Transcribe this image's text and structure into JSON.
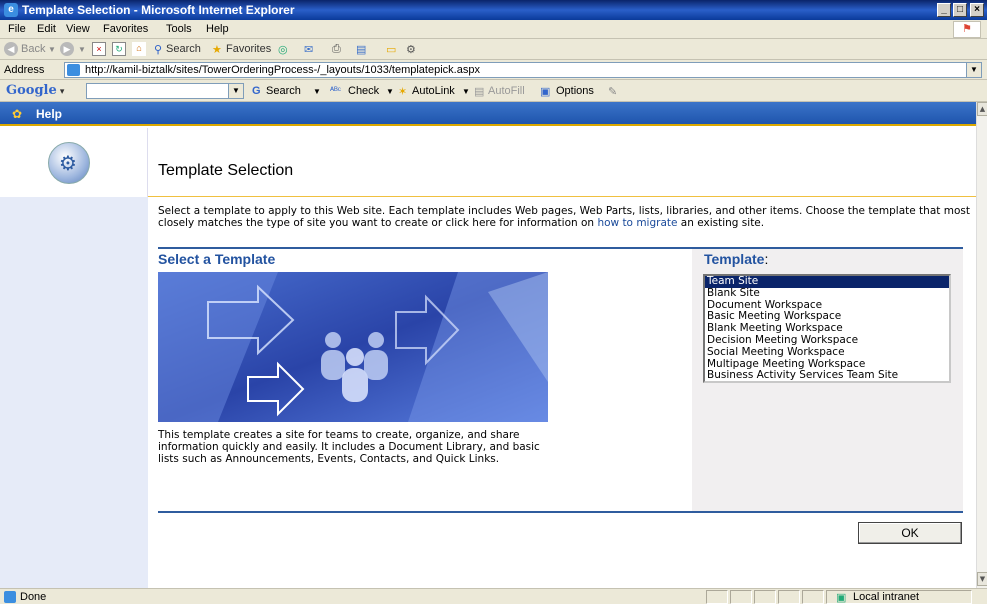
{
  "window": {
    "title": "Template Selection - Microsoft Internet Explorer"
  },
  "menu": [
    "File",
    "Edit",
    "View",
    "Favorites",
    "Tools",
    "Help"
  ],
  "toolbar": {
    "back": "Back",
    "search": "Search",
    "favorites": "Favorites"
  },
  "address": {
    "label": "Address",
    "url": "http://kamil-biztalk/sites/TowerOrderingProcess-/_layouts/1033/templatepick.aspx"
  },
  "google": {
    "logo": "Google",
    "search": "Search",
    "check": "Check",
    "autolink": "AutoLink",
    "autofill": "AutoFill",
    "options": "Options"
  },
  "sharepoint": {
    "help": "Help",
    "page_title": "Template Selection"
  },
  "description": {
    "text_before": "Select a template to apply to this Web site. Each template includes Web pages, Web Parts, lists, libraries, and other items. Choose the template that most closely matches the type of site you want to create or click here for information on ",
    "link": "how to migrate",
    "text_after": " an existing site."
  },
  "left": {
    "heading": "Select a Template",
    "template_description": "This template creates a site for teams to create, organize, and share information quickly and easily. It includes a Document Library, and basic lists such as Announcements, Events, Contacts, and Quick Links."
  },
  "right": {
    "heading": "Template",
    "heading_suffix": ":",
    "options": [
      "Team Site",
      "Blank Site",
      "Document Workspace",
      "Basic Meeting Workspace",
      "Blank Meeting Workspace",
      "Decision Meeting Workspace",
      "Social Meeting Workspace",
      "Multipage Meeting Workspace",
      "Business Activity Services Team Site"
    ],
    "selected": "Team Site"
  },
  "ok_label": "OK",
  "status": {
    "text": "Done",
    "zone": "Local intranet"
  },
  "colors": {
    "accent": "#2353a0",
    "nav_bg": "#e6ebf8",
    "selection": "#0a246a"
  }
}
